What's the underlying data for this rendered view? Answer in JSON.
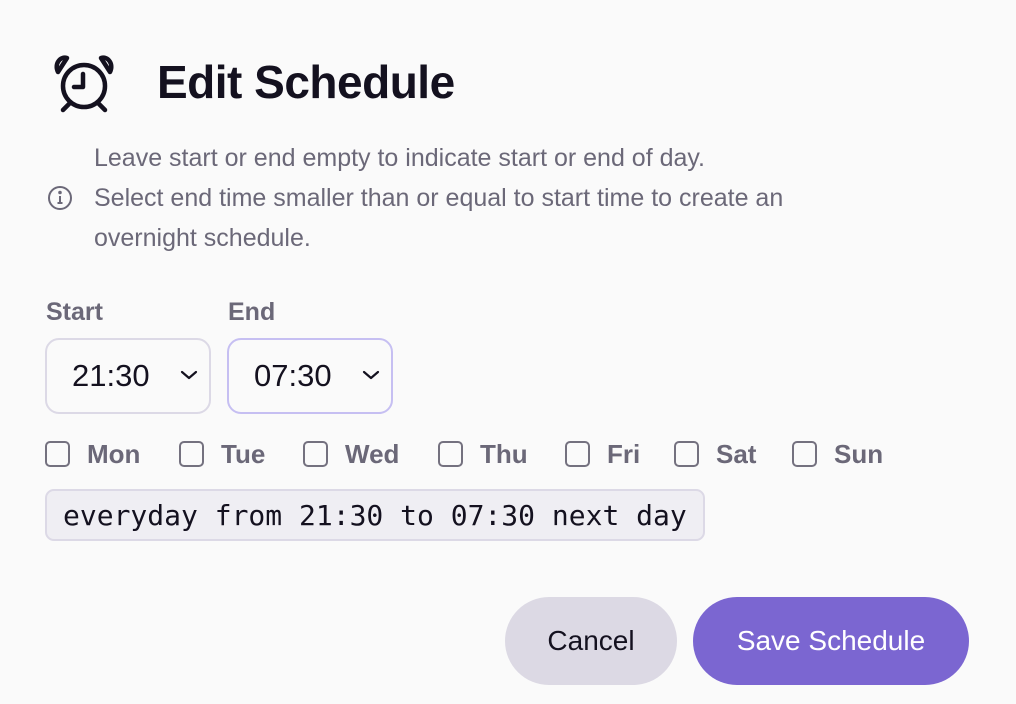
{
  "dialog": {
    "title": "Edit Schedule",
    "title_icon": "alarm-clock-icon",
    "info_icon": "info-circle-icon",
    "info_lines": [
      "Leave start or end empty to indicate start or end of day.",
      "Select end time smaller than or equal to start time to create an",
      "overnight schedule."
    ]
  },
  "fields": {
    "start": {
      "label": "Start",
      "value": "21:30"
    },
    "end": {
      "label": "End",
      "value": "07:30"
    }
  },
  "days": [
    {
      "label": "Mon",
      "checked": false
    },
    {
      "label": "Tue",
      "checked": false
    },
    {
      "label": "Wed",
      "checked": false
    },
    {
      "label": "Thu",
      "checked": false
    },
    {
      "label": "Fri",
      "checked": false
    },
    {
      "label": "Sat",
      "checked": false
    },
    {
      "label": "Sun",
      "checked": false
    }
  ],
  "summary": "everyday from 21:30 to 07:30 next day",
  "buttons": {
    "cancel": "Cancel",
    "save": "Save Schedule"
  },
  "colors": {
    "primary": "#7b66d1",
    "secondary": "#dcd9e4",
    "text": "#14111f",
    "muted": "#6b6878",
    "focus_border": "#c6bff2"
  }
}
